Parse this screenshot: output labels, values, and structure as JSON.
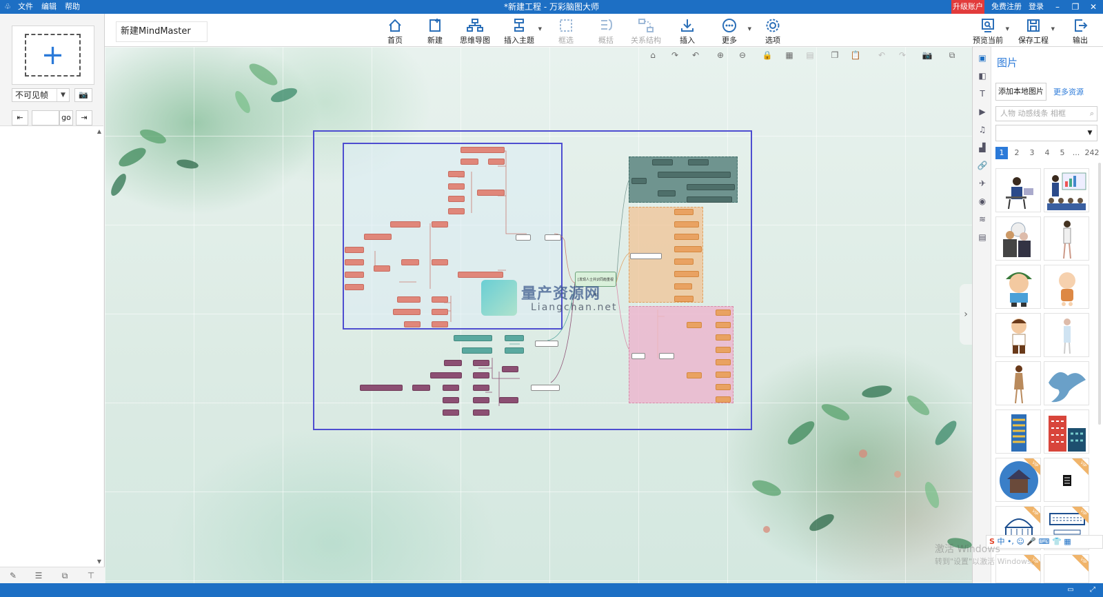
{
  "titlebar": {
    "title": "*新建工程 - 万彩脑图大师",
    "menus": [
      "文件",
      "编辑",
      "帮助"
    ],
    "upgrade": "升级账户",
    "register": "免费注册",
    "login": "登录"
  },
  "document": {
    "name": "新建MindMaster"
  },
  "ribbon": {
    "home": "首页",
    "new": "新建",
    "mindmap": "思维导图",
    "insert_topic": "插入主题",
    "frame_select": "框选",
    "summary": "概括",
    "relation": "关系结构",
    "insert": "插入",
    "more": "更多",
    "options": "选项",
    "preview": "预览当前",
    "save": "保存工程",
    "export": "输出"
  },
  "left_panel": {
    "visibility_select": "不可见帧",
    "go_label": "go",
    "frame_input_value": ""
  },
  "watermark": {
    "cn": "量产资源网",
    "en": "Liangchan.net"
  },
  "mindmap": {
    "root": "[发现人士共识同趋重视等]"
  },
  "right_panel": {
    "title": "图片",
    "add_local": "添加本地图片",
    "more_resources": "更多资源",
    "search_placeholder": "人物 动感线条 相框",
    "pages": [
      "1",
      "2",
      "3",
      "4",
      "5",
      "...",
      "242"
    ],
    "active_page": "1",
    "clipart": [
      "person-at-desk",
      "business-presentation",
      "two-people-talking",
      "standing-woman",
      "boy-with-hat",
      "baby",
      "cartoon-boy",
      "nurse",
      "woman-standing",
      "manta-ray",
      "blue-building",
      "red-building",
      "rainy-house",
      "phone-icon",
      "government-building",
      "computer-keyboard"
    ],
    "vip_label": "VIP"
  },
  "ime": {
    "label": "中"
  },
  "windows_activation": {
    "line1": "激活 Windows",
    "line2": "转到\"设置\"以激活 Windows。"
  },
  "colors": {
    "accent": "#1d6fc4",
    "upgrade": "#e23b3b",
    "frame": "#4d4dd0"
  }
}
